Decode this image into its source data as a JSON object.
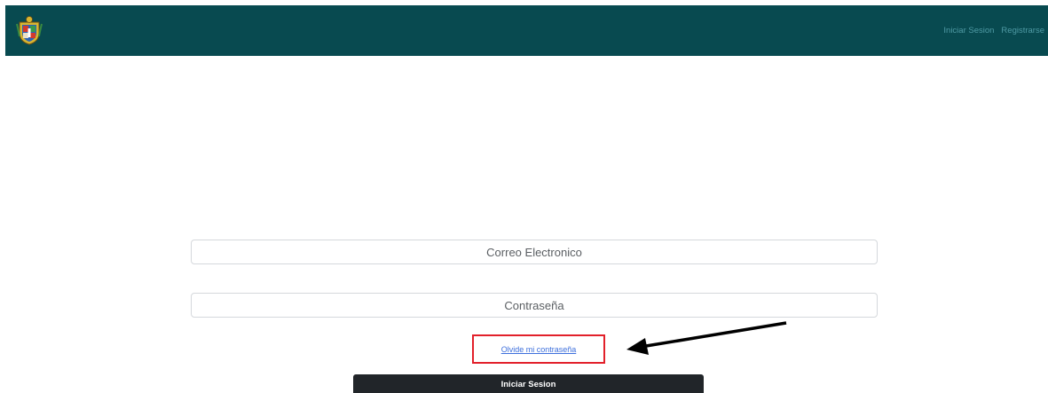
{
  "navbar": {
    "logo_icon": "coat-of-arms-icon",
    "links": {
      "login": "Iniciar Sesion",
      "register": "Registrarse"
    }
  },
  "form": {
    "email_placeholder": "Correo Electronico",
    "password_placeholder": "Contraseña",
    "forgot_password": "Olvide mi contraseña",
    "submit_label": "Iniciar Sesion"
  },
  "annotation": {
    "highlight_color": "#e2202a",
    "arrow_color": "#000000"
  },
  "colors": {
    "navbar_bg": "#084a50",
    "nav_link": "#4f9aa4",
    "link": "#3d6fdc",
    "button_bg": "#212529"
  }
}
